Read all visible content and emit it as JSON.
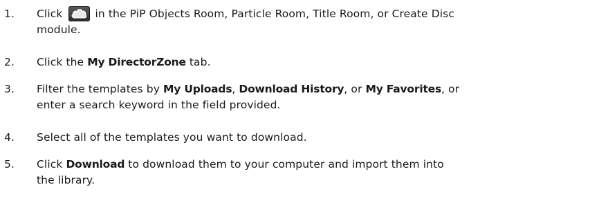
{
  "steps": [
    {
      "number": "1.",
      "parts": {
        "before_icon": "Click",
        "icon": "cloud-icon",
        "after_icon": "in the PiP Objects Room, Particle Room, Title Room, or Create Disc",
        "line2": "module."
      }
    },
    {
      "number": "2.",
      "parts": {
        "t1": "Click the ",
        "b1": "My DirectorZone",
        "t2": " tab."
      }
    },
    {
      "number": "3.",
      "parts": {
        "t1": "Filter the templates by ",
        "b1": "My Uploads",
        "t2": ", ",
        "b2": "Download History",
        "t3": ", or ",
        "b3": "My Favorites",
        "t4": ", or",
        "line2": "enter a search keyword in the field provided."
      }
    },
    {
      "number": "4.",
      "parts": {
        "t1": "Select all of the templates you want to download."
      }
    },
    {
      "number": "5.",
      "parts": {
        "t1": "Click ",
        "b1": "Download",
        "t2": " to download them to your computer and import them into",
        "line2": "the library."
      }
    }
  ]
}
